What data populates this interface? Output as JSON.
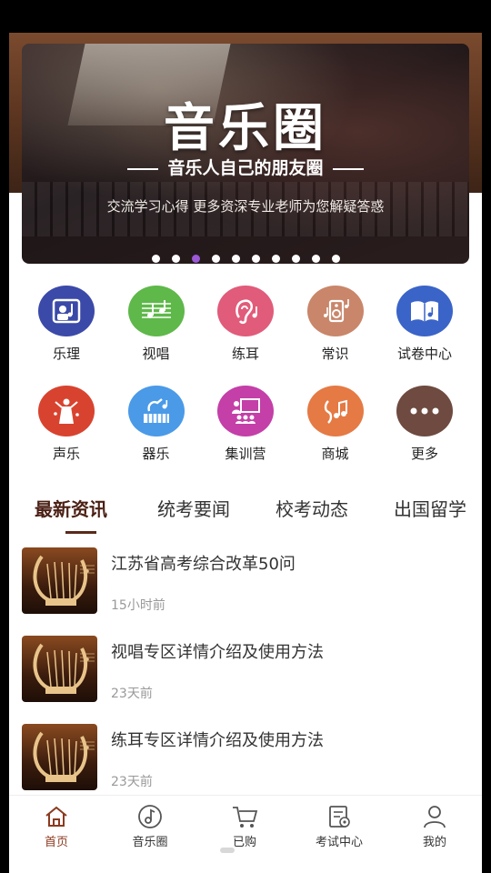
{
  "banner": {
    "title": "音乐圈",
    "subtitle": "音乐人自己的朋友圈",
    "description": "交流学习心得 更多资深专业老师为您解疑答惑",
    "dot_count": 10,
    "active_dot": 2
  },
  "grid": [
    {
      "label": "乐理",
      "icon": "theory-icon",
      "color": "#3b4aa8"
    },
    {
      "label": "视唱",
      "icon": "sight-singing-icon",
      "color": "#5fb84a"
    },
    {
      "label": "练耳",
      "icon": "ear-training-icon",
      "color": "#e15b7a"
    },
    {
      "label": "常识",
      "icon": "knowledge-icon",
      "color": "#c9866a"
    },
    {
      "label": "试卷中心",
      "icon": "exam-papers-icon",
      "color": "#3a64c8"
    },
    {
      "label": "声乐",
      "icon": "vocal-icon",
      "color": "#d8432f"
    },
    {
      "label": "器乐",
      "icon": "instrument-icon",
      "color": "#4a9ae8"
    },
    {
      "label": "集训营",
      "icon": "training-camp-icon",
      "color": "#c43fa8"
    },
    {
      "label": "商城",
      "icon": "mall-icon",
      "color": "#e57a44"
    },
    {
      "label": "更多",
      "icon": "more-icon",
      "color": "#6e4a40"
    }
  ],
  "tabs": [
    "最新资讯",
    "统考要闻",
    "校考动态",
    "出国留学"
  ],
  "news": [
    {
      "title": "江苏省高考综合改革50问",
      "time": "15小时前"
    },
    {
      "title": "视唱专区详情介绍及使用方法",
      "time": "23天前"
    },
    {
      "title": "练耳专区详情介绍及使用方法",
      "time": "23天前"
    }
  ],
  "bottom_nav": [
    {
      "label": "首页",
      "icon": "home-icon",
      "active": true
    },
    {
      "label": "音乐圈",
      "icon": "music-circle-icon",
      "active": false
    },
    {
      "label": "已购",
      "icon": "cart-icon",
      "active": false
    },
    {
      "label": "考试中心",
      "icon": "exam-center-icon",
      "active": false
    },
    {
      "label": "我的",
      "icon": "profile-icon",
      "active": false
    }
  ],
  "colors": {
    "accent": "#8b3a1f",
    "active_dot": "#9b59d6"
  }
}
